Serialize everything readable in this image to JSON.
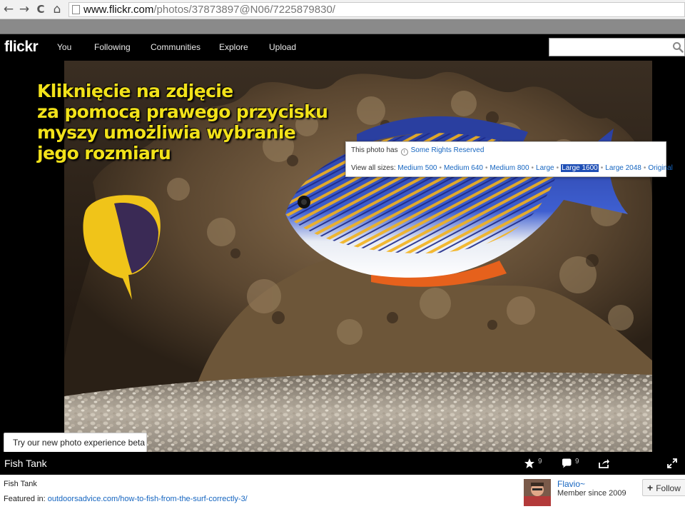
{
  "browser": {
    "back": "←",
    "forward": "→",
    "reload": "C",
    "home": "⌂",
    "url_domain": "www.flickr.com",
    "url_path": "/photos/37873897@N06/7225879830/"
  },
  "header": {
    "logo": "flickr",
    "nav": [
      "You",
      "Following",
      "Communities",
      "Explore",
      "Upload"
    ],
    "search_value": ""
  },
  "overlay": {
    "lines": [
      "Kliknięcie na zdjęcie",
      "za pomocą prawego przycisku",
      "myszy umożliwia wybranie",
      "jego rozmiaru"
    ],
    "color": "#f2e21a"
  },
  "popup": {
    "prefix": "This photo has",
    "rights_link": "Some Rights Reserved",
    "sizes_label": "View all sizes:",
    "sizes": [
      "Medium 500",
      "Medium 640",
      "Medium 800",
      "Large",
      "Large 1600",
      "Large 2048",
      "Original"
    ],
    "selected_size": "Large 1600"
  },
  "beta": {
    "label": "Try our new photo experience beta"
  },
  "photo_bar": {
    "title": "Fish Tank",
    "favorites": "9",
    "comments": "9"
  },
  "info": {
    "title": "Fish Tank",
    "featured_label": "Featured in:",
    "featured_link": "outdoorsadvice.com/how-to-fish-from-the-surf-correctly-3/",
    "owner": "Flavio~",
    "member_since": "Member since 2009",
    "follow": "Follow"
  }
}
